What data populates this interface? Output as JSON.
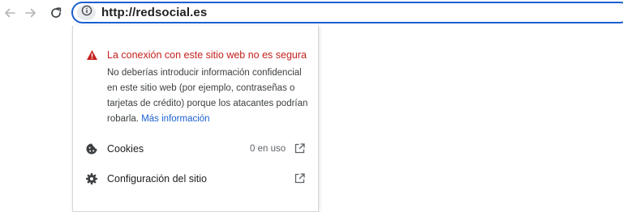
{
  "toolbar": {
    "back_icon": "arrow-left-icon",
    "forward_icon": "arrow-right-icon",
    "reload_icon": "reload-icon",
    "url": "http://redsocial.es",
    "site_info_icon": "info-icon",
    "focus_color": "#1a5fd0"
  },
  "popup": {
    "warning_icon": "warning-triangle-icon",
    "warning_title": "La conexión con este sitio web no es segura",
    "warning_body_lines": [
      "No deberías introducir información confidencial",
      "en este sitio web (por ejemplo, contraseñas o",
      "tarjetas de crédito) porque los atacantes podrían",
      "robarla."
    ],
    "more_info_link": "Más información",
    "rows": [
      {
        "icon": "cookie-icon",
        "label": "Cookies",
        "value": "0 en uso",
        "action_icon": "open-external-icon"
      },
      {
        "icon": "settings-gear-icon",
        "label": "Configuración del sitio",
        "value": "",
        "action_icon": "open-external-icon"
      }
    ],
    "warning_color": "#c5221f",
    "link_color": "#1a5fd0"
  }
}
